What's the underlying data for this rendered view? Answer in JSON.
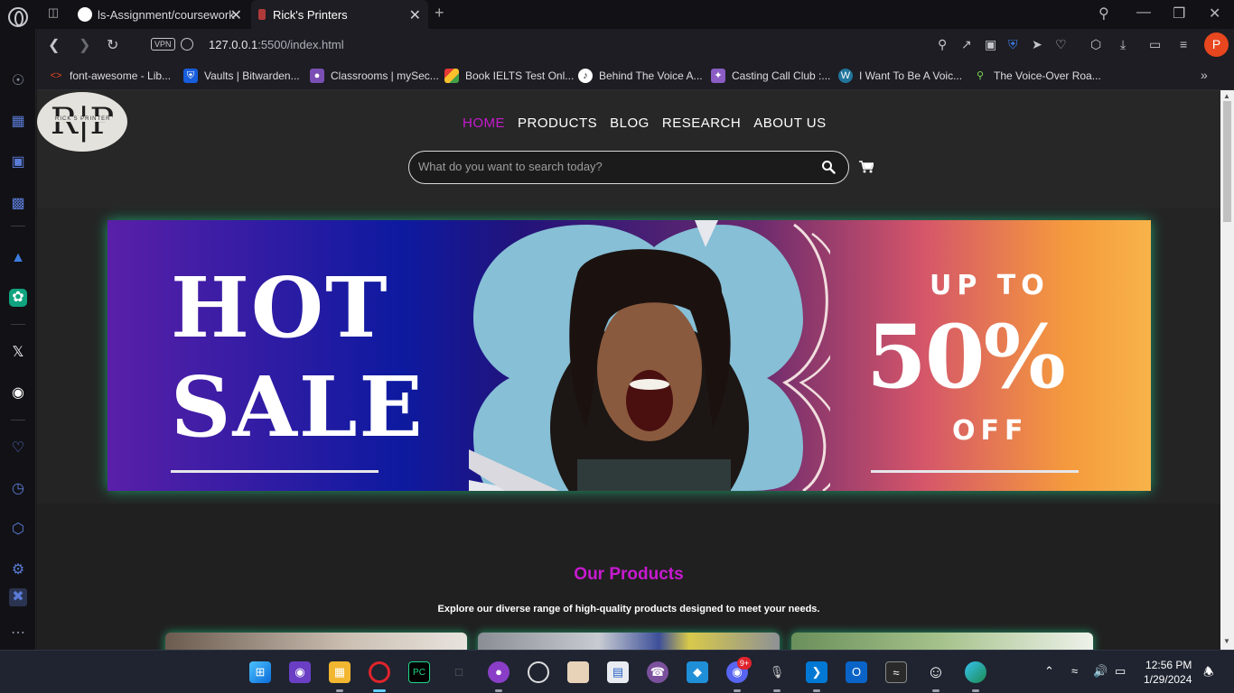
{
  "browser": {
    "tabs": [
      {
        "title": "ls-Assignment/coursework",
        "active": false
      },
      {
        "title": "Rick's Printers",
        "active": true
      }
    ],
    "url": {
      "host": "127.0.0.1",
      "rest": ":5500/index.html"
    },
    "vpn_label": "VPN",
    "profile_initial": "P",
    "accent_color": "#e8461e"
  },
  "bookmarks": [
    {
      "label": "font-awesome - Lib...",
      "icon": "code-icon"
    },
    {
      "label": "Vaults | Bitwarden...",
      "icon": "bitwarden-icon"
    },
    {
      "label": "Classrooms | mySec...",
      "icon": "classroom-icon"
    },
    {
      "label": "Book IELTS Test Onl...",
      "icon": "ielts-icon"
    },
    {
      "label": "Behind The Voice A...",
      "icon": "btva-icon"
    },
    {
      "label": "Casting Call Club :...",
      "icon": "casting-icon"
    },
    {
      "label": "I Want To Be A Voic...",
      "icon": "wordpress-icon"
    },
    {
      "label": "The Voice-Over Roa...",
      "icon": "voiceover-icon"
    }
  ],
  "site": {
    "logo_text": "R|P",
    "logo_sub": "RICK'S PRINTER",
    "nav": [
      {
        "label": "HOME",
        "active": true
      },
      {
        "label": "PRODUCTS",
        "active": false
      },
      {
        "label": "BLOG",
        "active": false
      },
      {
        "label": "RESEARCH",
        "active": false
      },
      {
        "label": "ABOUT US",
        "active": false
      }
    ],
    "search_placeholder": "What do you want to search today?",
    "active_color": "#c81ad0"
  },
  "banner": {
    "left_line1": "HOT",
    "left_line2": "SALE",
    "up_to": "UP TO",
    "percent": "50%",
    "off": "OFF"
  },
  "products": {
    "title": "Our Products",
    "subtitle": "Explore our diverse range of high-quality products designed to meet your needs."
  },
  "taskbar": {
    "time": "12:56 PM",
    "date": "1/29/2024",
    "discord_badge": "9+"
  }
}
